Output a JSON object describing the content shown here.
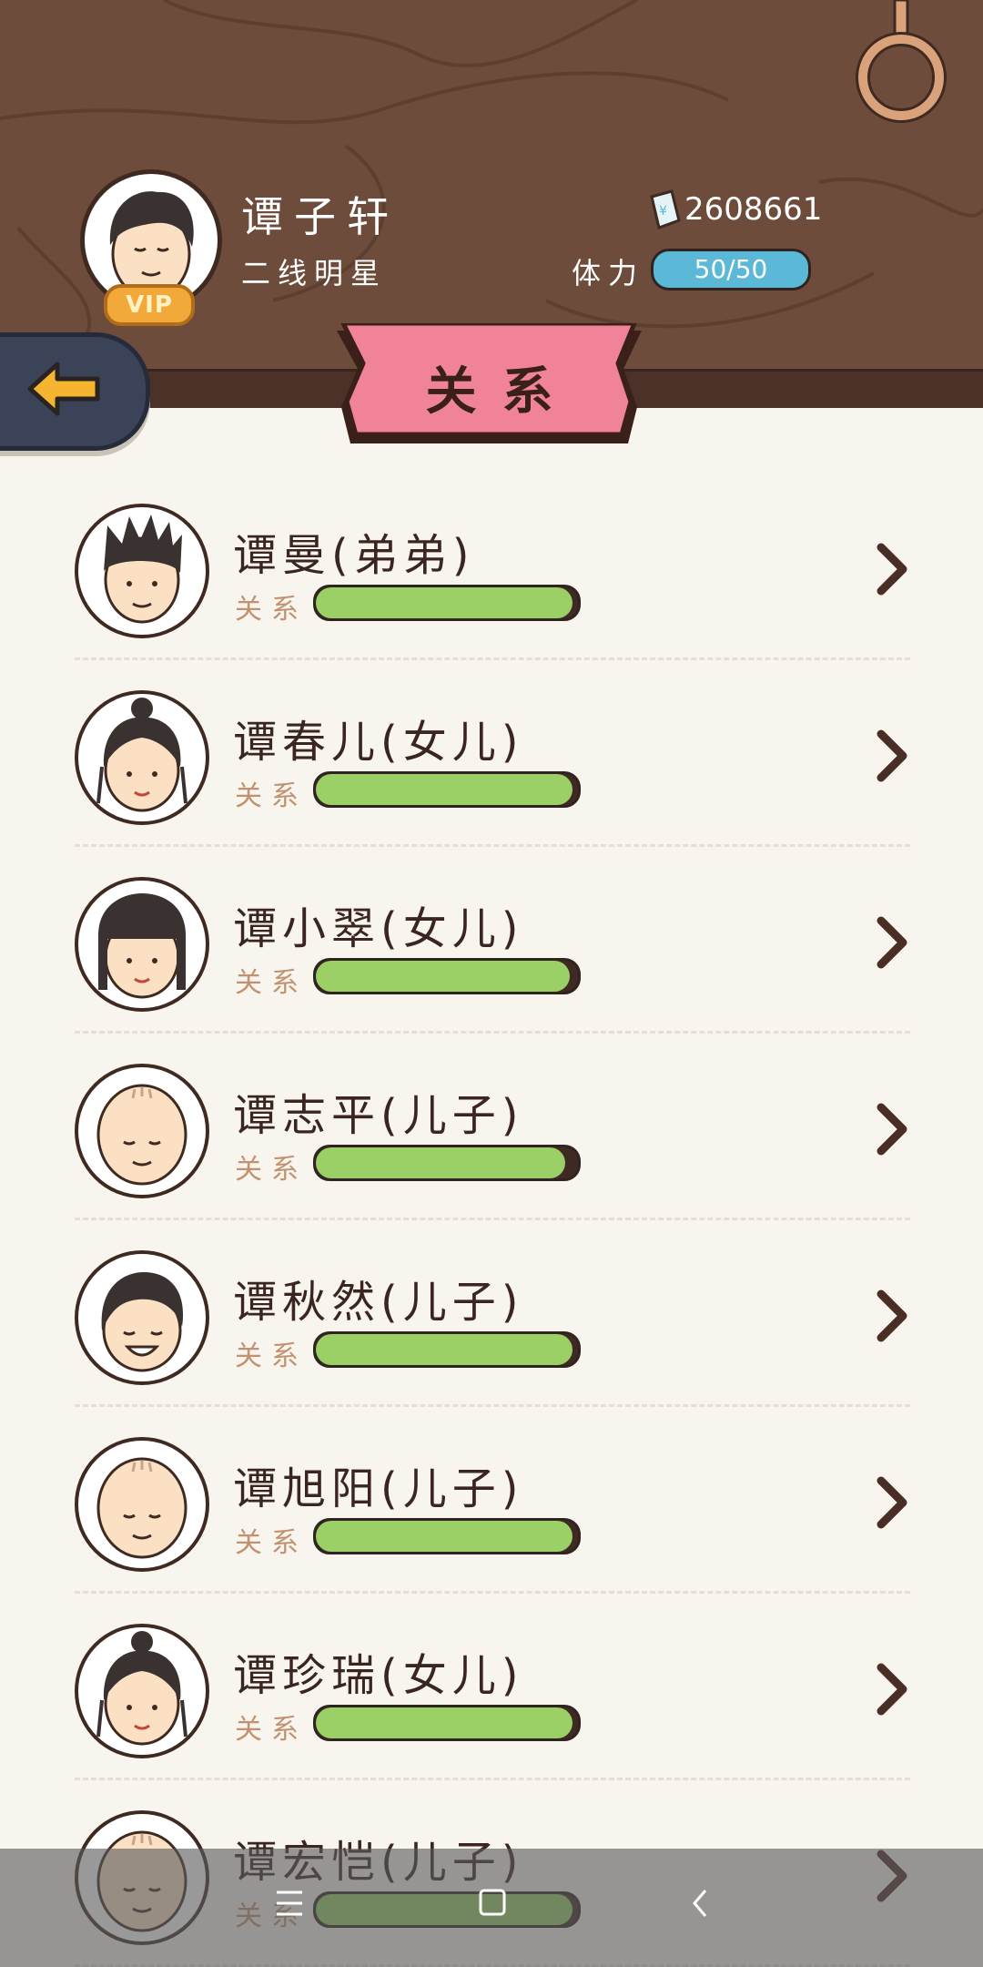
{
  "player": {
    "name": "谭子轩",
    "title": "二线明星",
    "vip_label": "VIP",
    "money": "2608661",
    "stamina_label": "体力",
    "stamina_value": "50/50"
  },
  "page": {
    "title": "关系"
  },
  "relation_label": "关系",
  "members": [
    {
      "name": "谭曼(弟弟)",
      "relation": 0.98,
      "avatar": "spiky-hair-boy"
    },
    {
      "name": "谭春儿(女儿)",
      "relation": 0.98,
      "avatar": "bun-hair-girl"
    },
    {
      "name": "谭小翠(女儿)",
      "relation": 0.97,
      "avatar": "bob-hair-girl"
    },
    {
      "name": "谭志平(儿子)",
      "relation": 0.95,
      "avatar": "bald-baby"
    },
    {
      "name": "谭秋然(儿子)",
      "relation": 0.98,
      "avatar": "short-hair-boy"
    },
    {
      "name": "谭旭阳(儿子)",
      "relation": 0.98,
      "avatar": "bald-baby"
    },
    {
      "name": "谭珍瑞(女儿)",
      "relation": 0.98,
      "avatar": "bun-hair-girl"
    },
    {
      "name": "谭宏恺(儿子)",
      "relation": 0.98,
      "avatar": "bald-baby"
    }
  ],
  "colors": {
    "wood": "#6e4c3c",
    "bar_fill": "#9ad066",
    "banner": "#f08398",
    "stamina": "#5bb8d6"
  },
  "icons": {
    "back": "left-arrow-icon",
    "chevron": "chevron-right-icon",
    "money": "banknote-icon",
    "nav": [
      "menu-icon",
      "home-square-icon",
      "back-chevron-icon"
    ]
  }
}
